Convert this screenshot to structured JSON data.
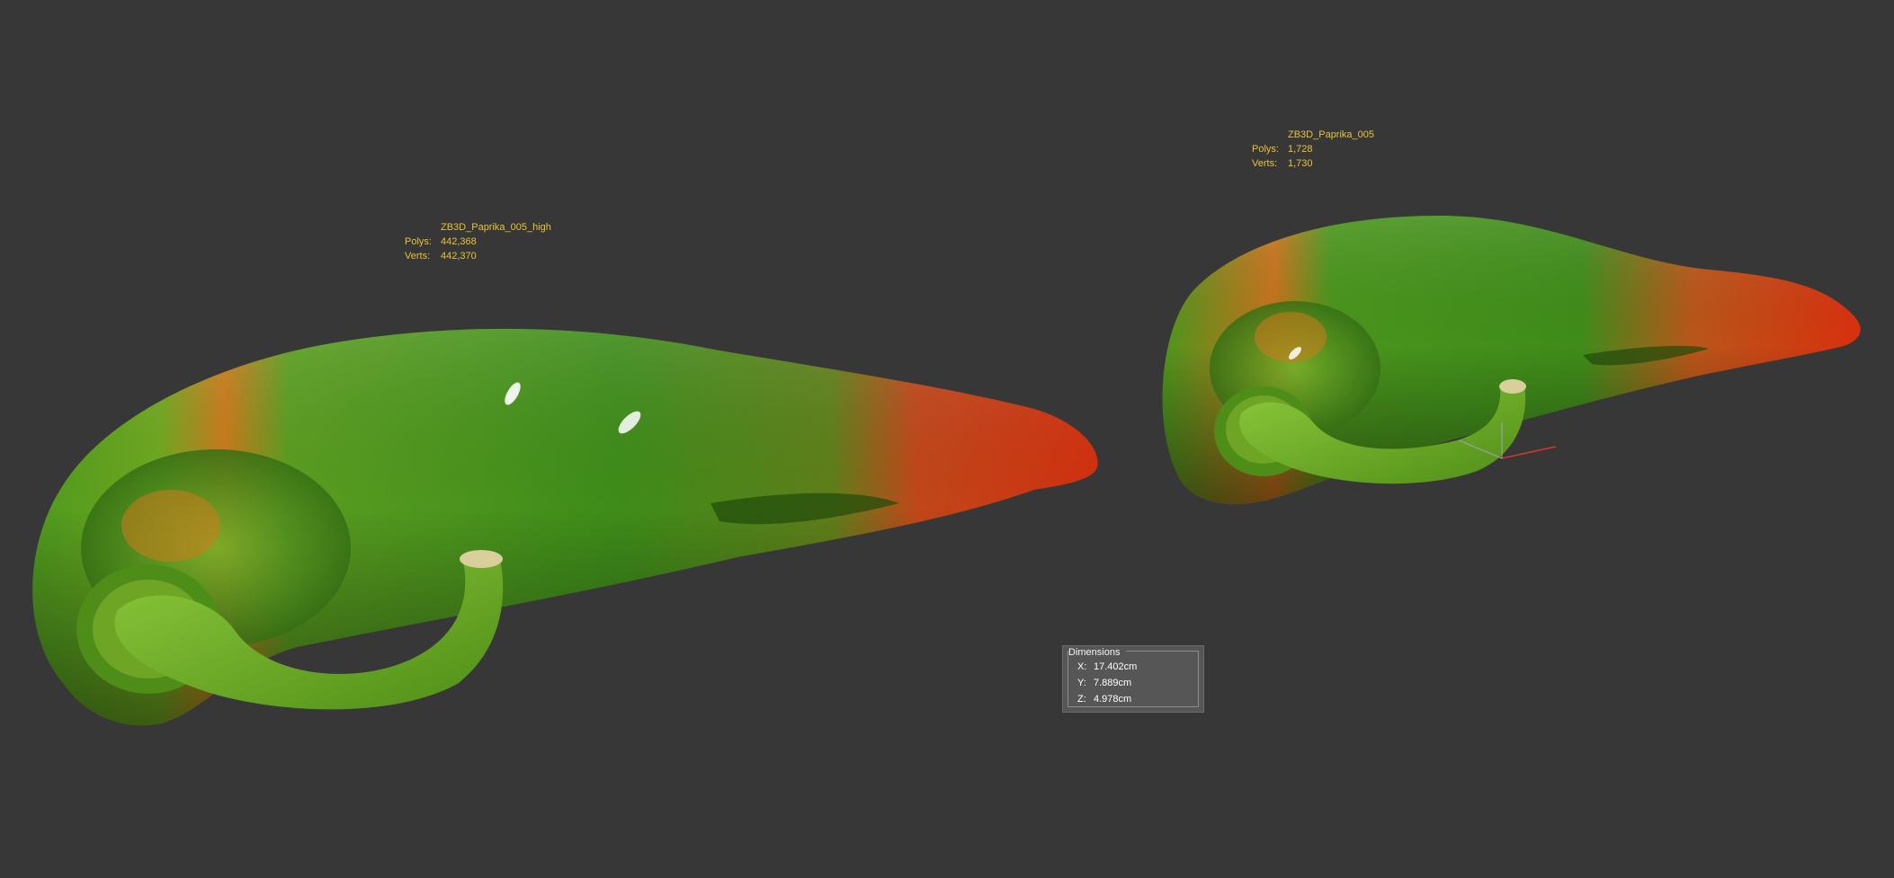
{
  "viewport": {
    "background": "#373737",
    "objects": [
      {
        "name": "ZB3D_Paprika_005_high",
        "polys_label": "Polys:",
        "polys": "442,368",
        "verts_label": "Verts:",
        "verts": "442,370"
      },
      {
        "name": "ZB3D_Paprika_005",
        "polys_label": "Polys:",
        "polys": "1,728",
        "verts_label": "Verts:",
        "verts": "1,730"
      }
    ],
    "stats_color": "#e8c23a"
  },
  "dimensions": {
    "title": "Dimensions",
    "x_label": "X:",
    "x": "17.402cm",
    "y_label": "Y:",
    "y": "7.889cm",
    "z_label": "Z:",
    "z": "4.978cm"
  },
  "colors": {
    "pepper_green": "#3f8f1c",
    "pepper_red": "#c8300e",
    "stem_green": "#6fb52a"
  },
  "icons": [
    "transform-gizmo-icon"
  ]
}
